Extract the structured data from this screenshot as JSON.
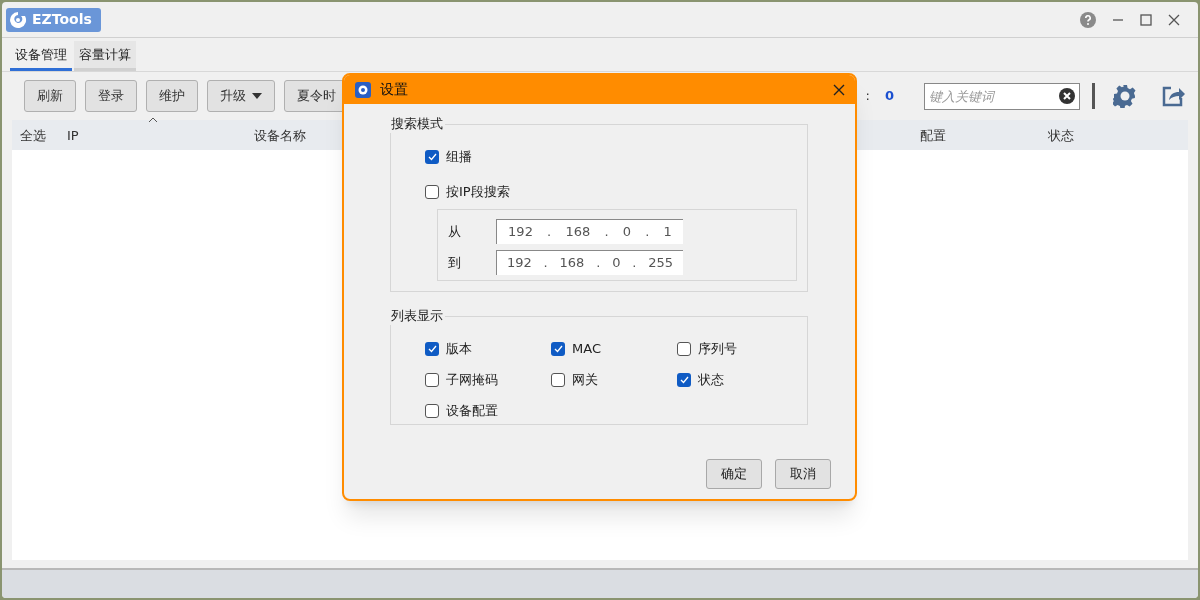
{
  "window": {
    "title": "EZTools"
  },
  "tabs": [
    {
      "label": "设备管理",
      "selected": true
    },
    {
      "label": "容量计算",
      "selected": false
    }
  ],
  "toolbar": {
    "buttons": [
      {
        "label": "刷新",
        "kind": "plain"
      },
      {
        "label": "登录",
        "kind": "plain"
      },
      {
        "label": "维护",
        "kind": "plain"
      },
      {
        "label": "升级",
        "kind": "dropdown"
      },
      {
        "label": "夏令时",
        "kind": "plain"
      }
    ],
    "count_label": ":",
    "count": "0",
    "search": {
      "placeholder": "键入关键词"
    }
  },
  "table": {
    "columns": [
      {
        "label": "全选"
      },
      {
        "label": "IP"
      },
      {
        "label": "设备名称"
      },
      {
        "label": "配置"
      },
      {
        "label": "状态"
      }
    ]
  },
  "dialog": {
    "title": "设置",
    "search_mode": {
      "title": "搜索模式",
      "options": [
        {
          "label": "组播",
          "checked": true
        },
        {
          "label": "按IP段搜索",
          "checked": false
        }
      ],
      "range": [
        {
          "label": "从",
          "segments": [
            "192",
            ".",
            "168",
            ".",
            "0",
            ".",
            "1"
          ]
        },
        {
          "label": "到",
          "segments": [
            "192",
            ".",
            "168",
            ".",
            "0",
            ".",
            "255"
          ]
        }
      ]
    },
    "list_display": {
      "title": "列表显示",
      "options": [
        {
          "label": "版本",
          "checked": true
        },
        {
          "label": "MAC",
          "checked": true
        },
        {
          "label": "序列号",
          "checked": false
        },
        {
          "label": "子网掩码",
          "checked": false
        },
        {
          "label": "网关",
          "checked": false
        },
        {
          "label": "状态",
          "checked": true
        },
        {
          "label": "设备配置",
          "checked": false
        }
      ]
    },
    "buttons": [
      "确定",
      "取消"
    ]
  }
}
